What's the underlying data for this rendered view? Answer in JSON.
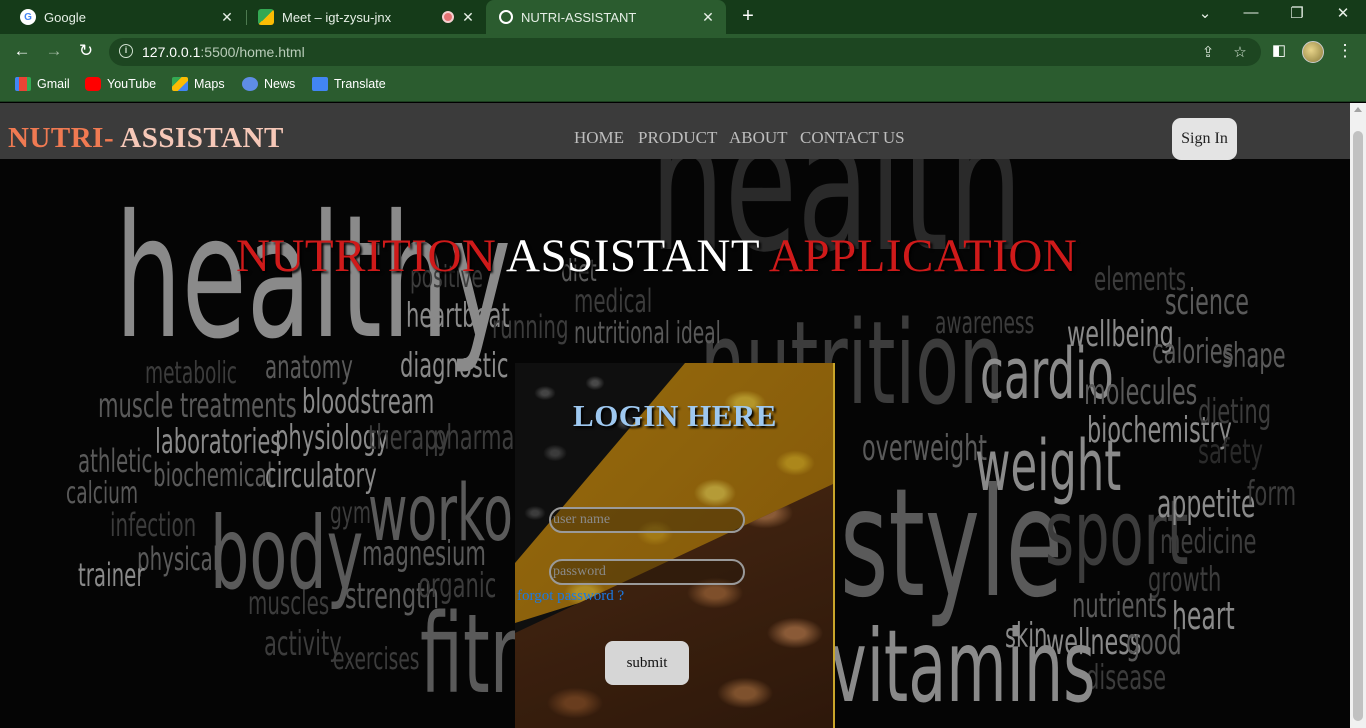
{
  "browser": {
    "tabs": [
      {
        "title": "Google",
        "favicon": "google-icon",
        "active": false
      },
      {
        "title": "Meet – igt-zysu-jnx",
        "favicon": "google-meet-icon",
        "active": false,
        "recording": true
      },
      {
        "title": "NUTRI-ASSISTANT",
        "favicon": "globe-icon",
        "active": true
      }
    ],
    "url_host": "127.0.0.1",
    "url_rest": ":5500/home.html",
    "bookmarks": [
      {
        "label": "Gmail",
        "icon": "gmail-icon"
      },
      {
        "label": "YouTube",
        "icon": "youtube-icon"
      },
      {
        "label": "Maps",
        "icon": "maps-icon"
      },
      {
        "label": "News",
        "icon": "news-icon"
      },
      {
        "label": "Translate",
        "icon": "translate-icon"
      }
    ]
  },
  "page": {
    "brand_part1": "NUTRI-",
    "brand_part2": " ASSISTANT",
    "nav": [
      "HOME",
      "PRODUCT",
      "ABOUT",
      "CONTACT US"
    ],
    "signin_label": "Sign In",
    "hero_word1": "NUTRITION",
    "hero_word2": "ASSISTANT",
    "hero_word3": "APPLICATION",
    "login": {
      "title": "LOGIN HERE",
      "username_placeholder": "user name",
      "password_placeholder": "password",
      "forgot_label": "forgot password ?",
      "submit_label": "submit"
    },
    "background_words": [
      "healthy",
      "health",
      "nutrition",
      "heartbeat",
      "running",
      "nutritional ideal",
      "diagnostic",
      "anatomy",
      "metabolic",
      "muscle treatments",
      "bloodstream",
      "laboratories",
      "physiology",
      "therapy",
      "pharmacy",
      "athletic",
      "biochemical",
      "circulatory",
      "calcium",
      "infection",
      "physical",
      "trainer",
      "body",
      "workout",
      "magnesium",
      "muscles",
      "strength",
      "organic",
      "activity",
      "exercises",
      "fitness",
      "gym",
      "cardio",
      "molecules",
      "biochemistry",
      "overweight",
      "weight",
      "style",
      "sport",
      "appetite",
      "medicine",
      "growth",
      "heart",
      "nutrients",
      "skin",
      "wellness",
      "good",
      "disease",
      "vitamins",
      "science",
      "wellbeing",
      "calories",
      "shape",
      "dieting",
      "safety",
      "form",
      "awareness",
      "elements",
      "medical",
      "positive",
      "diet"
    ]
  },
  "colors": {
    "brand_orange": "#f07a52",
    "brand_pink": "#f6c8b8",
    "hero_red": "#cf1a1a",
    "login_title_blue": "#9ec8f0",
    "link_blue": "#1a7ae6",
    "chrome_green": "#2b5c2f"
  }
}
